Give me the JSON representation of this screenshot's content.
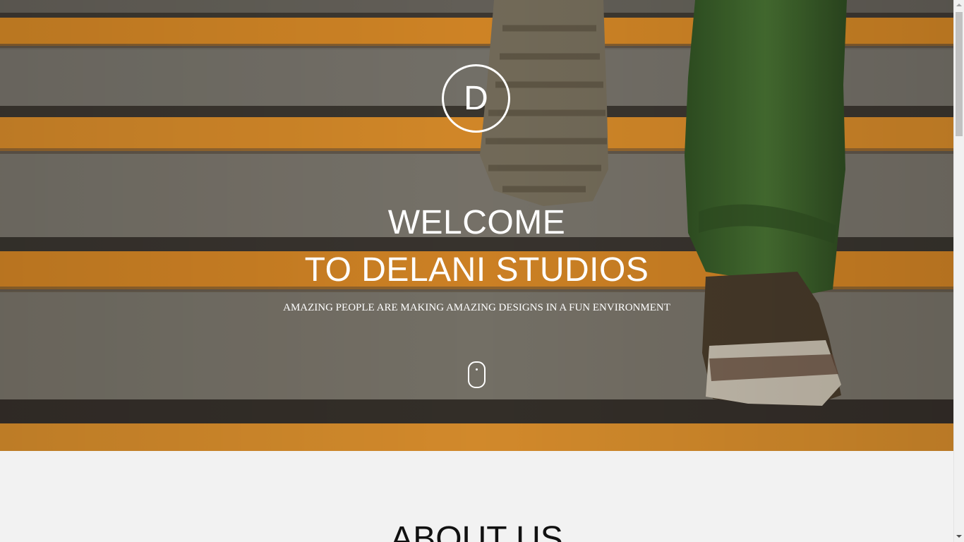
{
  "hero": {
    "logo_letter": "D",
    "headline_line1": "WELCOME",
    "headline_line2": "TO DELANI STUDIOS",
    "tagline": "AMAZING PEOPLE ARE MAKING AMAZING DESIGNS IN A FUN ENVIRONMENT",
    "scroll_indicator_icon": "mouse-scroll-icon",
    "background_image": "photo of a person in green trousers and sneakers climbing grey stairs with orange stripes"
  },
  "about": {
    "title": "ABOUT US"
  },
  "scrollbar": {
    "up_icon": "chevron-up-icon",
    "down_icon": "chevron-down-icon"
  },
  "colors": {
    "stripe_orange": "#e8922a",
    "step_grey": "#7a7873",
    "trouser_green": "#3f6b2e",
    "text_white": "#ffffff",
    "about_background": "#f2f2f2"
  }
}
